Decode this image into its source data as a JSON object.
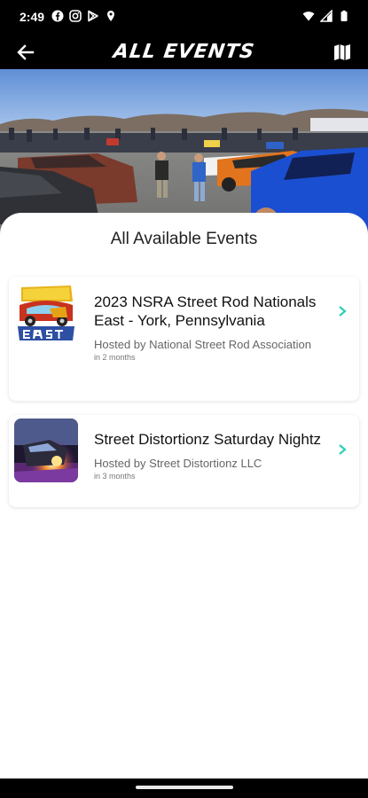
{
  "status_bar": {
    "time": "2:49",
    "left_icons": [
      "facebook-icon",
      "instagram-icon",
      "play-store-icon",
      "location-icon"
    ],
    "right_icons": [
      "wifi-icon",
      "signal-icon",
      "battery-icon"
    ]
  },
  "app_bar": {
    "title": "ALL EVENTS",
    "back_icon": "back-arrow-icon",
    "map_icon": "map-icon"
  },
  "colors": {
    "accent": "#2ad1b8",
    "app_bar_bg": "#000000",
    "sheet_bg": "#ffffff"
  },
  "sheet": {
    "title": "All Available Events"
  },
  "events": [
    {
      "name": "2023 NSRA Street Rod Nationals East - York, Pennsylvania",
      "host": "Hosted by National Street Rod Association",
      "when": "in 2 months",
      "thumb_icon": "street-rod-nationals-east-logo"
    },
    {
      "name": "Street Distortionz Saturday Nightz",
      "host": "Hosted by Street Distortionz LLC",
      "when": "in 3 months",
      "thumb_icon": "drag-car-photo"
    }
  ]
}
